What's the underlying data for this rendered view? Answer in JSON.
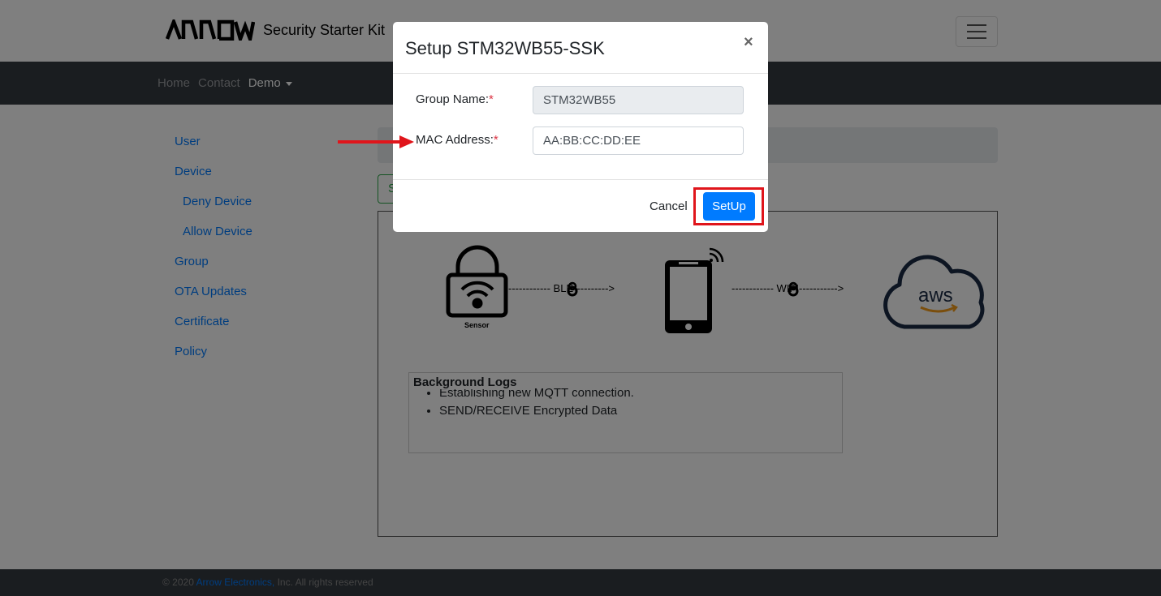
{
  "header": {
    "brand_text": "Security Starter Kit",
    "logo_text": "ARROW"
  },
  "nav": {
    "items": [
      {
        "label": "Home"
      },
      {
        "label": "Contact"
      },
      {
        "label": "Demo"
      }
    ]
  },
  "sidebar": {
    "items": [
      {
        "label": "User"
      },
      {
        "label": "Device"
      },
      {
        "label": "Deny Device"
      },
      {
        "label": "Allow Device"
      },
      {
        "label": "Group"
      },
      {
        "label": "OTA Updates"
      },
      {
        "label": "Certificate"
      },
      {
        "label": "Policy"
      }
    ]
  },
  "content": {
    "green_button_label": "S"
  },
  "diagram": {
    "sensor_label": "Sensor",
    "ble_label": "------------ BLE---------->",
    "wifi_label": "------------ WIFI----------->",
    "aws_label": "aws"
  },
  "logs": {
    "title": "Background Logs",
    "items": [
      "Establishing new MQTT connection.",
      "SEND/RECEIVE Encrypted Data"
    ]
  },
  "footer": {
    "prefix": "© 2020 ",
    "link": "Arrow Electronics,",
    "suffix": " Inc. All rights reserved"
  },
  "modal": {
    "title": "Setup STM32WB55-SSK",
    "close_symbol": "×",
    "group_label": "Group Name:",
    "group_value": "STM32WB55",
    "mac_label": "MAC Address:",
    "mac_value": "AA:BB:CC:DD:EE",
    "required_mark": "*",
    "cancel_label": "Cancel",
    "setup_label": "SetUp"
  },
  "colors": {
    "primary": "#007bff",
    "navbar": "#343a40",
    "annotation": "#e0151b",
    "required": "#dc3545"
  }
}
